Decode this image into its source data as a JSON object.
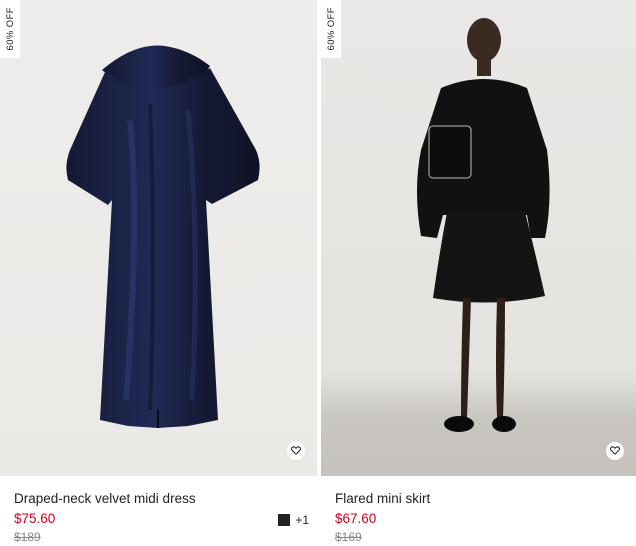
{
  "products": [
    {
      "badge": "60% OFF",
      "name": "Draped-neck velvet midi dress",
      "sale_price": "$75.60",
      "original_price": "$189",
      "more_colors": "+1",
      "swatch_color": "#222222",
      "favorite_icon": "heart-icon"
    },
    {
      "badge": "60% OFF",
      "name": "Flared mini skirt",
      "sale_price": "$67.60",
      "original_price": "$169",
      "favorite_icon": "heart-icon"
    }
  ],
  "colors": {
    "sale": "#d6001c",
    "text": "#222222",
    "strike": "#888888"
  }
}
